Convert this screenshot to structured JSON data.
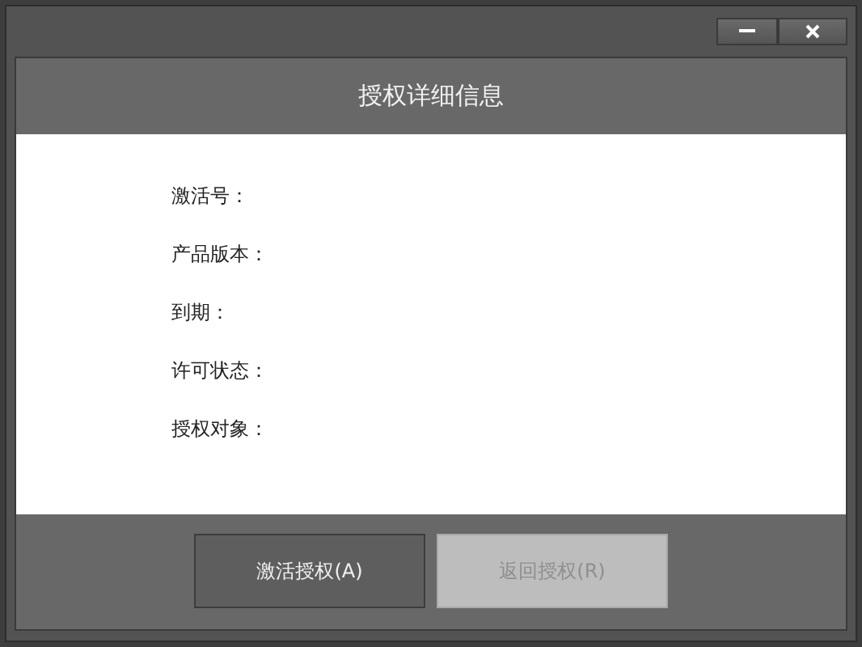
{
  "dialog": {
    "title": "授权详细信息"
  },
  "fields": [
    {
      "label": "激活号："
    },
    {
      "label": "产品版本："
    },
    {
      "label": "到期："
    },
    {
      "label": "许可状态："
    },
    {
      "label": "授权对象："
    }
  ],
  "buttons": [
    {
      "label": "激活授权(A)",
      "disabled": false
    },
    {
      "label": "返回授权(R)",
      "disabled": true
    }
  ]
}
